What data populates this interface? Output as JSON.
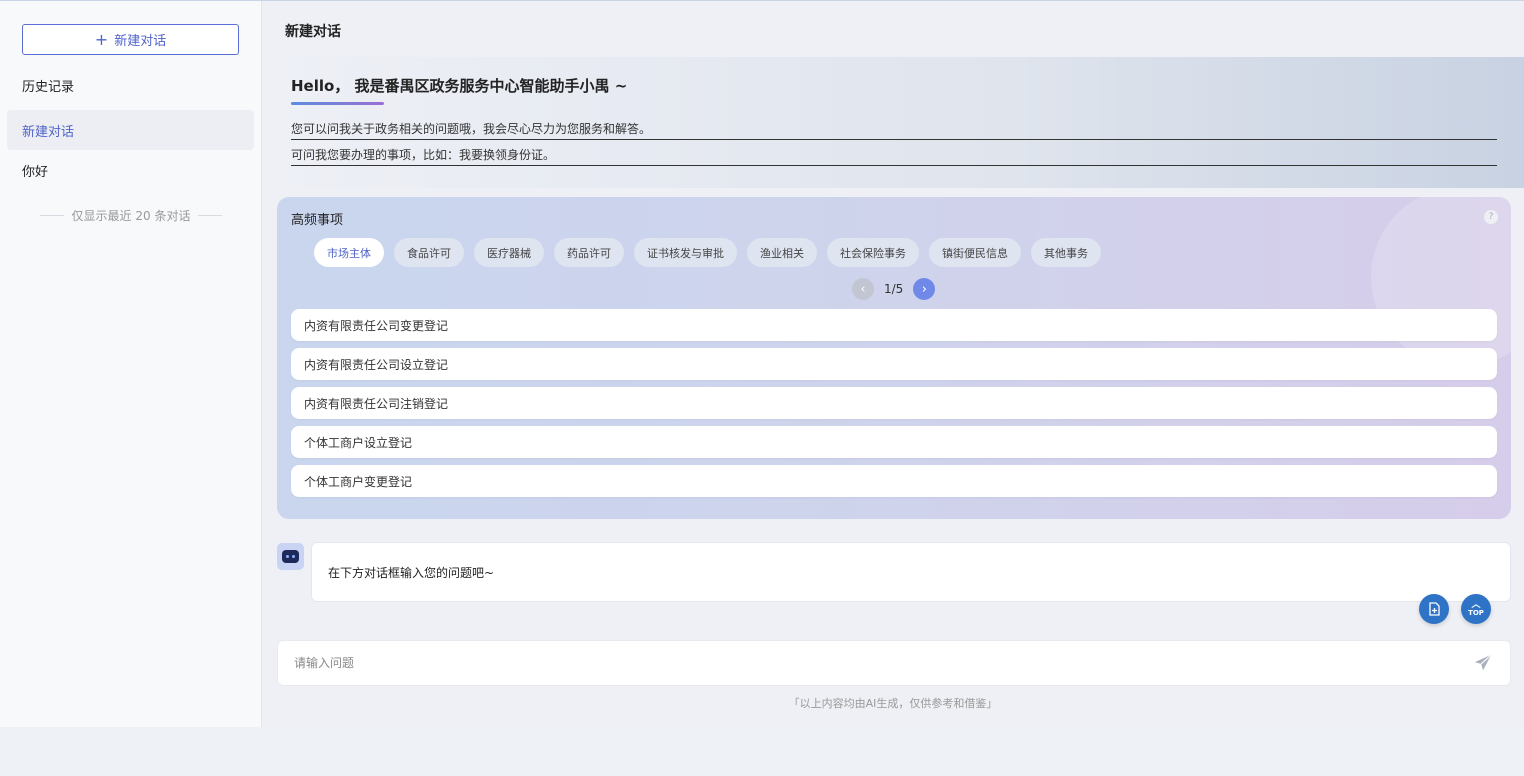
{
  "sidebar": {
    "new_chat_label": "新建对话",
    "history_title": "历史记录",
    "items": [
      {
        "label": "新建对话"
      },
      {
        "label": "你好"
      }
    ],
    "recent_note": "仅显示最近 20 条对话"
  },
  "header": {
    "title": "新建对话"
  },
  "welcome": {
    "greeting": "Hello， 我是番禺区政务服务中心智能助手小禺 ~",
    "line1": "您可以问我关于政务相关的问题哦，我会尽心尽力为您服务和解答。",
    "line2": "可问我您要办理的事项，比如：我要换领身份证。"
  },
  "frequent": {
    "title": "高频事项",
    "tabs": [
      {
        "label": "市场主体"
      },
      {
        "label": "食品许可"
      },
      {
        "label": "医疗器械"
      },
      {
        "label": "药品许可"
      },
      {
        "label": "证书核发与审批"
      },
      {
        "label": "渔业相关"
      },
      {
        "label": "社会保险事务"
      },
      {
        "label": "镇街便民信息"
      },
      {
        "label": "其他事务"
      }
    ],
    "pager": "1/5",
    "items": [
      {
        "label": "内资有限责任公司变更登记"
      },
      {
        "label": "内资有限责任公司设立登记"
      },
      {
        "label": "内资有限责任公司注销登记"
      },
      {
        "label": "个体工商户设立登记"
      },
      {
        "label": "个体工商户变更登记"
      }
    ]
  },
  "bot": {
    "message": "在下方对话框输入您的问题吧~"
  },
  "fab": {
    "top_label": "TOP"
  },
  "input": {
    "placeholder": "请输入问题",
    "value": ""
  },
  "disclaimer": "「以上内容均由AI生成，仅供参考和借鉴」",
  "colors": {
    "accent": "#4f63c9",
    "fab": "#2f73c7"
  }
}
